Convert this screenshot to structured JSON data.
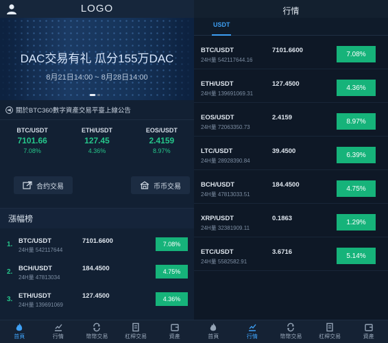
{
  "left": {
    "logo": "LOGO",
    "banner": {
      "title": "DAC交易有礼 瓜分155万DAC",
      "dates": "8月21日14:00 ~ 8月28日14:00"
    },
    "notice": "關於BTC360數字資產交易平臺上線公告",
    "tickers": [
      {
        "pair": "BTC/USDT",
        "price": "7101.66",
        "pct": "7.08%"
      },
      {
        "pair": "ETH/USDT",
        "price": "127.45",
        "pct": "4.36%"
      },
      {
        "pair": "EOS/USDT",
        "price": "2.4159",
        "pct": "8.97%"
      }
    ],
    "actions": {
      "contract": "合约交易",
      "coin": "币币交易"
    },
    "gainers": {
      "title": "漲幅榜",
      "rows": [
        {
          "idx": "1.",
          "pair": "BTC/USDT",
          "vol": "24H量 542117644",
          "price": "7101.6600",
          "pct": "7.08%"
        },
        {
          "idx": "2.",
          "pair": "BCH/USDT",
          "vol": "24H量 47813034",
          "price": "184.4500",
          "pct": "4.75%"
        },
        {
          "idx": "3.",
          "pair": "ETH/USDT",
          "vol": "24H量 139691069",
          "price": "127.4500",
          "pct": "4.36%"
        }
      ]
    }
  },
  "right": {
    "title": "行情",
    "tab": "USDT",
    "rows": [
      {
        "pair": "BTC/USDT",
        "vol": "24H量  542117644.16",
        "price": "7101.6600",
        "pct": "7.08%"
      },
      {
        "pair": "ETH/USDT",
        "vol": "24H量  139691069.31",
        "price": "127.4500",
        "pct": "4.36%"
      },
      {
        "pair": "EOS/USDT",
        "vol": "24H量  72063350.73",
        "price": "2.4159",
        "pct": "8.97%"
      },
      {
        "pair": "LTC/USDT",
        "vol": "24H量  28928390.84",
        "price": "39.4500",
        "pct": "6.39%"
      },
      {
        "pair": "BCH/USDT",
        "vol": "24H量  47813033.51",
        "price": "184.4500",
        "pct": "4.75%"
      },
      {
        "pair": "XRP/USDT",
        "vol": "24H量  32381909.11",
        "price": "0.1863",
        "pct": "1.29%"
      },
      {
        "pair": "ETC/USDT",
        "vol": "24H量  5582582.91",
        "price": "3.6716",
        "pct": "5.14%"
      }
    ]
  },
  "nav": {
    "items": [
      "首頁",
      "行情",
      "幣幣交易",
      "杠桿交易",
      "資產"
    ]
  },
  "colors": {
    "up": "#16b37a",
    "accent": "#3ea0f5",
    "bg": "#0d1726"
  }
}
